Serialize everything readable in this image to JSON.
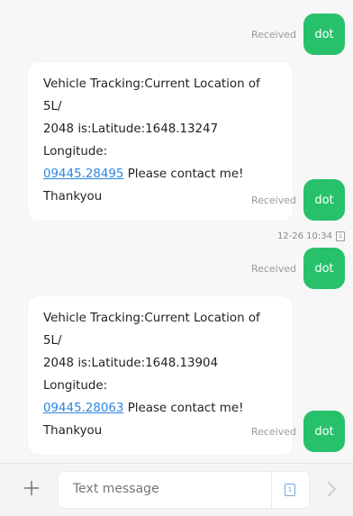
{
  "messages": [
    {
      "type": "out",
      "status": "Received",
      "text": "dot"
    },
    {
      "type": "in",
      "line1": "Vehicle Tracking:Current Location of 5L/",
      "line2": "2048 is:Latitude:1648.13247 Longitude:",
      "link": "09445.28495",
      "after_link": " Please contact me!",
      "line4": "Thankyou"
    },
    {
      "type": "out",
      "status": "Received",
      "text": "dot"
    },
    {
      "type": "out",
      "status": "Received",
      "text": "dot"
    },
    {
      "type": "in",
      "line1": "Vehicle Tracking:Current Location of 5L/",
      "line2": "2048 is:Latitude:1648.13904 Longitude:",
      "link": "09445.28063",
      "after_link": " Please contact me!",
      "line4": "Thankyou"
    },
    {
      "type": "out",
      "status": "Received",
      "text": "dot"
    }
  ],
  "timestamp": {
    "text": "12-26 10:34",
    "sim": "1"
  },
  "composer": {
    "placeholder": "Text message",
    "sim_label": "1"
  },
  "colors": {
    "accent": "#27c16b",
    "link": "#2b86e0",
    "background": "#f7f7f7"
  },
  "icons": {
    "add": "plus-icon",
    "send": "chevron-right-icon"
  }
}
